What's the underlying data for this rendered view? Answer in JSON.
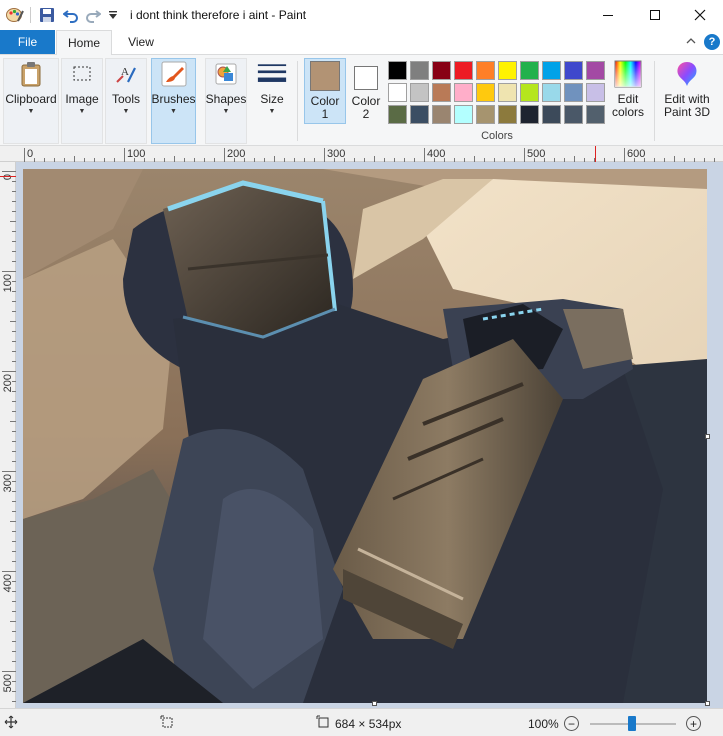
{
  "window": {
    "title": "i dont think therefore i aint - Paint",
    "minimize": "—",
    "maximize": "☐",
    "close": "✕"
  },
  "tabs": {
    "file": "File",
    "home": "Home",
    "view": "View"
  },
  "help_label": "?",
  "ribbon": {
    "clipboard": "Clipboard",
    "image": "Image",
    "tools": "Tools",
    "brushes": "Brushes",
    "shapes": "Shapes",
    "size": "Size",
    "color1_line1": "Color",
    "color1_line2": "1",
    "color2_line1": "Color",
    "color2_line2": "2",
    "edit_colors_line1": "Edit",
    "edit_colors_line2": "colors",
    "paint3d_line1": "Edit with",
    "paint3d_line2": "Paint 3D",
    "colors_group": "Colors",
    "color1_value": "#b29374",
    "color2_value": "#ffffff"
  },
  "palette": [
    "#000000",
    "#7f7f7f",
    "#880015",
    "#ed1c24",
    "#ff7f27",
    "#fff200",
    "#22b14c",
    "#00a2e8",
    "#3f48cc",
    "#a349a4",
    "#ffffff",
    "#c3c3c3",
    "#b97a57",
    "#ffaec9",
    "#ffc90e",
    "#efe4b0",
    "#b5e61d",
    "#99d9ea",
    "#7092be",
    "#c8bfe7",
    "#5a6b45",
    "#3b4e63",
    "#9a8570",
    "#b3ffff",
    "#a6946f",
    "#8c7a3d",
    "#1e2430",
    "#3c4a5a",
    "#4a5868",
    "#52606d"
  ],
  "ruler": {
    "h": [
      "0",
      "100",
      "200",
      "300",
      "400",
      "500",
      "600"
    ],
    "v": [
      "0",
      "100",
      "200",
      "300",
      "400",
      "500"
    ]
  },
  "status": {
    "dimensions": "684 × 534px",
    "zoom": "100%",
    "minus": "−",
    "plus": "+"
  }
}
